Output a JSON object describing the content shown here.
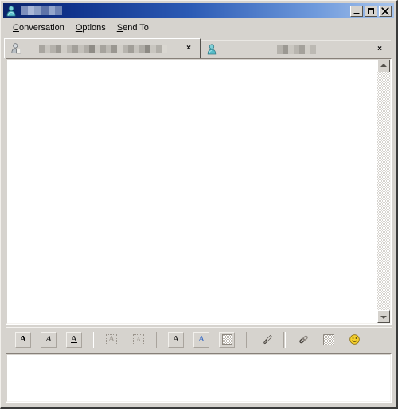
{
  "window": {
    "title_redacted": true,
    "title_icon": "contact-person-icon",
    "accent_start": "#0a246a",
    "accent_end": "#a7c4ec",
    "face_color": "#d6d3ce",
    "controls": {
      "minimize_label": "_",
      "maximize_label": "□",
      "close_label": "×"
    }
  },
  "menubar": {
    "items": [
      {
        "label": "Conversation",
        "mnemonic": "C",
        "rest": "onversation"
      },
      {
        "label": "Options",
        "mnemonic": "O",
        "rest": "ptions"
      },
      {
        "label": "Send To",
        "mnemonic": "S",
        "rest": "end To"
      }
    ]
  },
  "tabs": [
    {
      "name": "conversation-tab-1",
      "icon": "contact-person-icon",
      "label_redacted": true,
      "active": true,
      "close_label": "×"
    },
    {
      "name": "conversation-tab-2",
      "icon": "contact-person-blue-icon",
      "label_redacted": true,
      "active": false,
      "close_label": "×"
    }
  ],
  "history": {
    "content": "",
    "background": "#ffffff"
  },
  "scrollbar": {
    "up_label": "▲",
    "down_label": "▼",
    "thumb_visible": false
  },
  "toolbar": {
    "groups": [
      {
        "buttons": [
          {
            "name": "bold-button",
            "icon": "bold-A-icon",
            "glyph": "A",
            "style": "bold",
            "enabled": true
          },
          {
            "name": "italic-button",
            "icon": "italic-A-icon",
            "glyph": "A",
            "style": "italic",
            "enabled": true
          },
          {
            "name": "underline-button",
            "icon": "underline-A-icon",
            "glyph": "A",
            "style": "underline",
            "enabled": true
          }
        ]
      },
      {
        "buttons": [
          {
            "name": "increase-font-size-button",
            "icon": "font-grow-icon",
            "glyph": "A",
            "style": "plain",
            "enabled": false
          },
          {
            "name": "decrease-font-size-button",
            "icon": "font-shrink-icon",
            "glyph": "A",
            "style": "small",
            "enabled": false
          }
        ]
      },
      {
        "buttons": [
          {
            "name": "font-family-button",
            "icon": "font-select-icon",
            "glyph": "A",
            "style": "serif",
            "enabled": true
          },
          {
            "name": "font-color-button",
            "icon": "font-color-icon",
            "glyph": "A",
            "style": "color",
            "enabled": true
          },
          {
            "name": "background-color-button",
            "icon": "background-color-icon",
            "glyph": "",
            "style": "swatch",
            "enabled": true
          }
        ]
      },
      {
        "buttons": [
          {
            "name": "format-paint-button",
            "icon": "paintbrush-icon",
            "glyph": "✎",
            "style": "plain",
            "enabled": true
          }
        ]
      },
      {
        "buttons": [
          {
            "name": "insert-link-button",
            "icon": "chain-link-icon",
            "glyph": "⚭",
            "style": "plain",
            "enabled": true
          },
          {
            "name": "insert-image-button",
            "icon": "image-icon",
            "glyph": "",
            "style": "swatch",
            "enabled": true
          },
          {
            "name": "insert-emoticon-button",
            "icon": "smiley-face-icon",
            "glyph": "🙂",
            "style": "emoji",
            "enabled": true
          }
        ]
      }
    ]
  },
  "message_input": {
    "value": "",
    "placeholder": ""
  },
  "redaction": {
    "title_blocks": [
      "#7e90bc",
      "#a9b8d8",
      "#8da0c6",
      "#5d73a8",
      "#93a6cc",
      "#6d83b4"
    ],
    "tab1_blocks": [
      "#a8a59f",
      "#c8c5bf",
      "#b4b1ab",
      "#9d9a94",
      "#d0cdc7",
      "#bab7b1",
      "#a3a09a",
      "#c4c1bb",
      "#b0ada7",
      "#8f8c86",
      "#cbc8c2",
      "#a6a39d",
      "#bdbab4",
      "#9a9791",
      "#d2cfc9",
      "#b7b4ae",
      "#a19e98",
      "#c6c3bd",
      "#aeaba5",
      "#8d8a84",
      "#c9c6c0",
      "#b2afa9",
      "#dad7d1"
    ],
    "tab2_blocks": [
      "#b5b2ac",
      "#9b9892",
      "#cac7c1",
      "#b8b5af",
      "#a4a19b",
      "#d1cec8",
      "#bcb9b3"
    ]
  }
}
